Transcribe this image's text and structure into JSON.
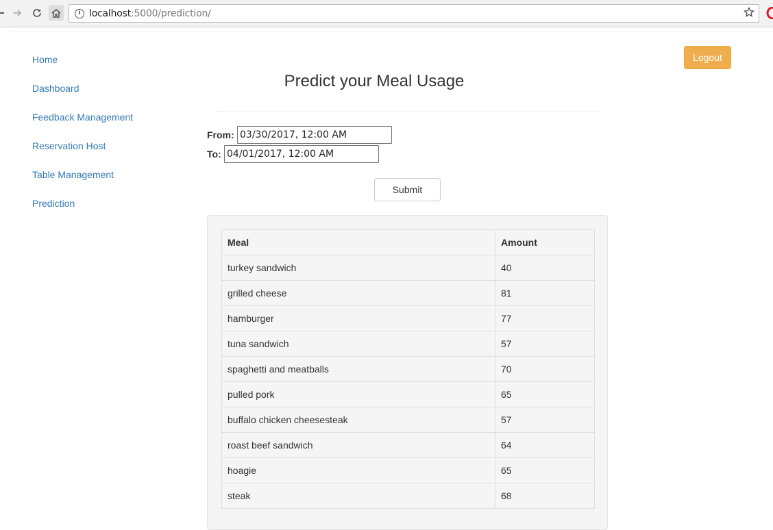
{
  "browser": {
    "url_host": "localhost",
    "url_path": ":5000/prediction/"
  },
  "sidebar": {
    "items": [
      {
        "label": "Home"
      },
      {
        "label": "Dashboard"
      },
      {
        "label": "Feedback Management"
      },
      {
        "label": "Reservation Host"
      },
      {
        "label": "Table Management"
      },
      {
        "label": "Prediction"
      }
    ]
  },
  "header": {
    "logout_label": "Logout",
    "title": "Predict your Meal Usage"
  },
  "form": {
    "from_label": "From:",
    "from_value": "03/30/2017, 12:00  AM",
    "to_label": "To:",
    "to_value": "04/01/2017, 12:00  AM",
    "submit_label": "Submit"
  },
  "table": {
    "headers": [
      "Meal",
      "Amount"
    ],
    "rows": [
      [
        "turkey sandwich",
        "40"
      ],
      [
        "grilled cheese",
        "81"
      ],
      [
        "hamburger",
        "77"
      ],
      [
        "tuna sandwich",
        "57"
      ],
      [
        "spaghetti and meatballs",
        "70"
      ],
      [
        "pulled pork",
        "65"
      ],
      [
        "buffalo chicken cheesesteak",
        "57"
      ],
      [
        "roast beef sandwich",
        "64"
      ],
      [
        "hoagie",
        "65"
      ],
      [
        "steak",
        "68"
      ]
    ]
  },
  "colors": {
    "link": "#337ab7",
    "logout_bg": "#f0ad4e"
  }
}
